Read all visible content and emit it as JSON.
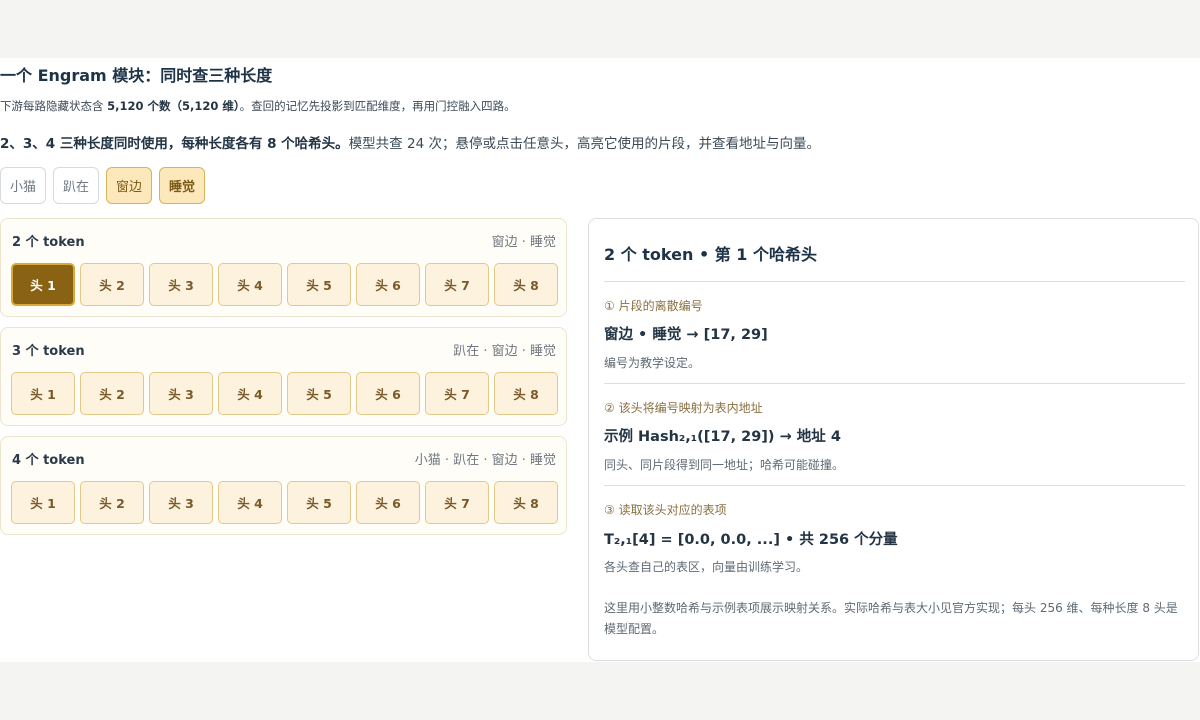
{
  "title": "一个 Engram 模块：同时查三种长度",
  "subtitle": {
    "part1": "下游每路隐藏状态含 ",
    "bold1": "5,120 个数（5,120 维）",
    "part2": "。查回的记忆先投影到匹配维度，再用门控融入四路。"
  },
  "intro": {
    "bold": "2、3、4 三种长度同时使用，每种长度各有 8 个哈希头。",
    "rest": "模型共查 24 次；悬停或点击任意头，高亮它使用的片段，并查看地址与向量。"
  },
  "tokens": [
    "小猫",
    "趴在",
    "窗边",
    "睡觉"
  ],
  "panels": [
    {
      "title": "2 个 token",
      "segment": "窗边 · 睡觉",
      "heads": [
        "头 1",
        "头 2",
        "头 3",
        "头 4",
        "头 5",
        "头 6",
        "头 7",
        "头 8"
      ]
    },
    {
      "title": "3 个 token",
      "segment": "趴在 · 窗边 · 睡觉",
      "heads": [
        "头 1",
        "头 2",
        "头 3",
        "头 4",
        "头 5",
        "头 6",
        "头 7",
        "头 8"
      ]
    },
    {
      "title": "4 个 token",
      "segment": "小猫 · 趴在 · 窗边 · 睡觉",
      "heads": [
        "头 1",
        "头 2",
        "头 3",
        "头 4",
        "头 5",
        "头 6",
        "头 7",
        "头 8"
      ]
    }
  ],
  "selected": {
    "panel": 0,
    "head": 0
  },
  "detail": {
    "title": "2 个 token • 第 1 个哈希头",
    "step1": {
      "label": "① 片段的离散编号",
      "value": "窗边 • 睡觉 → [17, 29]",
      "note": "编号为教学设定。"
    },
    "step2": {
      "label": "② 该头将编号映射为表内地址",
      "value": "示例 Hash₂,₁([17, 29]) → 地址 4",
      "note": "同头、同片段得到同一地址；哈希可能碰撞。"
    },
    "step3": {
      "label": "③ 读取该头对应的表项",
      "value": "T₂,₁[4] = [0.0, 0.0, ...] • 共 256 个分量",
      "note": "各头查自己的表区，向量由训练学习。"
    },
    "footnote": "这里用小整数哈希与示例表项展示映射关系。实际哈希与表大小见官方实现；每头 256 维、每种长度 8 头是模型配置。"
  }
}
